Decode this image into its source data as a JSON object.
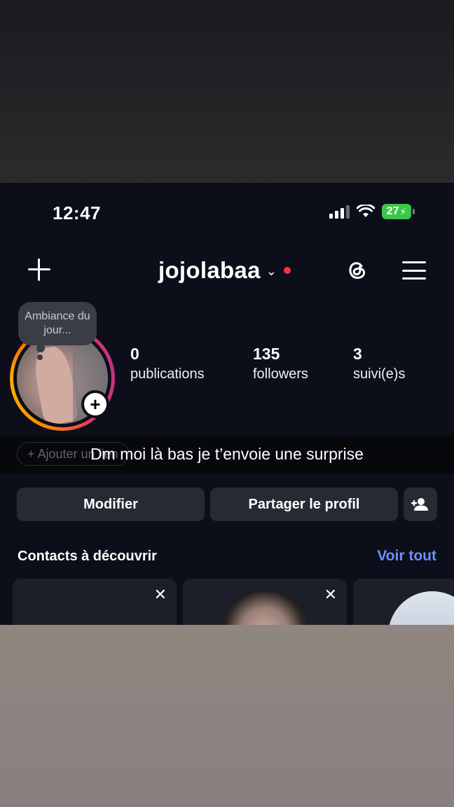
{
  "status_bar": {
    "time": "12:47",
    "battery": "27"
  },
  "header": {
    "username": "jojolabaa",
    "chevron": "⌄"
  },
  "profile": {
    "note": "Ambiance du jour...",
    "add_story": "+"
  },
  "stats": [
    {
      "value": "0",
      "label": "publications"
    },
    {
      "value": "135",
      "label": "followers"
    },
    {
      "value": "3",
      "label": "suivi(e)s"
    }
  ],
  "bio_chip": "+ Ajouter un lien",
  "caption": "Dm moi là bas je t’envoie une surprise",
  "buttons": {
    "edit": "Modifier",
    "share": "Partager le profil"
  },
  "suggestions": {
    "title": "Contacts à découvrir",
    "see_all": "Voir tout",
    "close": "✕"
  },
  "colors": {
    "background": "#0c0f19",
    "button": "#262a33",
    "link": "#708dff",
    "notification_dot": "#ff3040",
    "battery": "#3cc64a"
  },
  "icons": [
    "plus-icon",
    "chevron-down-icon",
    "threads-icon",
    "menu-icon",
    "add-person-icon",
    "close-icon",
    "signal-icon",
    "wifi-icon",
    "battery-icon"
  ]
}
